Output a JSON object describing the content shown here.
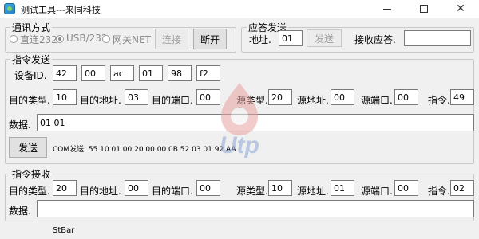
{
  "window": {
    "title": "测试工具---来同科技"
  },
  "comm": {
    "legend": "通讯方式",
    "radios": [
      {
        "label": "直连232",
        "checked": false
      },
      {
        "label": "USB/232",
        "checked": true
      },
      {
        "label": "网关NET",
        "checked": false
      }
    ],
    "connect_label": "连接",
    "disconnect_label": "断开"
  },
  "reply": {
    "legend": "应答发送",
    "address_label": "地址.",
    "address_value": "01",
    "send_label": "发送",
    "recv_label": "接收应答.",
    "recv_value": ""
  },
  "command_send": {
    "legend": "指令发送",
    "device_id_label": "设备ID.",
    "device_id_values": [
      "42",
      "00",
      "ac",
      "01",
      "98",
      "f2"
    ],
    "dest_type_label": "目的类型.",
    "dest_type_value": "10",
    "dest_addr_label": "目的地址.",
    "dest_addr_value": "03",
    "dest_port_label": "目的端口.",
    "dest_port_value": "00",
    "src_type_label": "源类型.",
    "src_type_value": "20",
    "src_addr_label": "源地址.",
    "src_addr_value": "00",
    "src_port_label": "源端口.",
    "src_port_value": "00",
    "cmd_label": "指令.",
    "cmd_value": "49",
    "data_label": "数据.",
    "data_value": "01 01",
    "send_label": "发送",
    "com_text": "COM发送, 55 10 01 00 20 00 00 0B 52 03 01 92 AA"
  },
  "command_recv": {
    "legend": "指令接收",
    "dest_type_label": "目的类型.",
    "dest_type_value": "20",
    "dest_addr_label": "目的地址.",
    "dest_addr_value": "00",
    "dest_port_label": "目的端口.",
    "dest_port_value": "00",
    "src_type_label": "源类型.",
    "src_type_value": "10",
    "src_addr_label": "源地址.",
    "src_addr_value": "01",
    "src_port_label": "源端口.",
    "src_port_value": "00",
    "cmd_label": "指令.",
    "cmd_value": "02",
    "data_label": "数据.",
    "data_value": ""
  },
  "statusbar": {
    "text": "StBar"
  },
  "watermark": {
    "text": "Utp",
    "colors": {
      "drop": "#d9534f",
      "text": "#5a7fc4"
    }
  }
}
